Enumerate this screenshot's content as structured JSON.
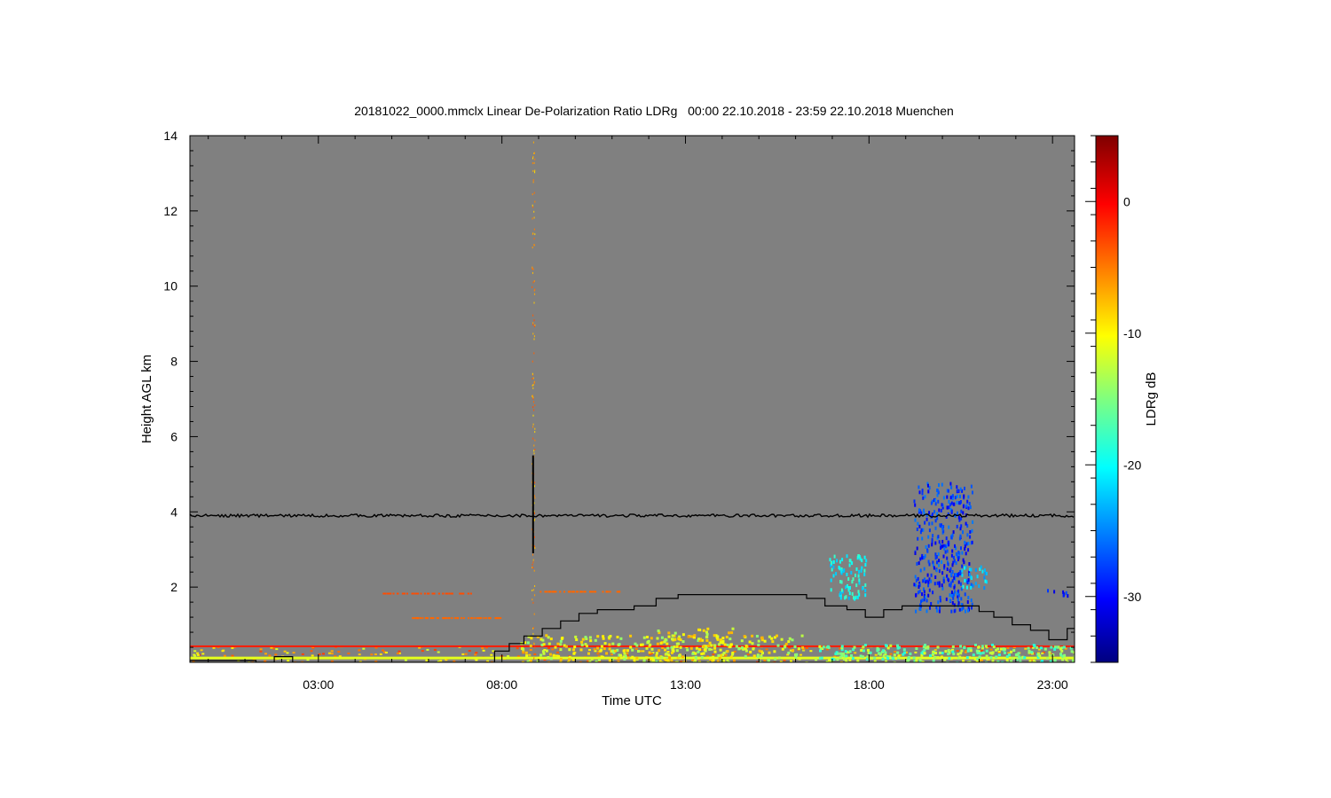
{
  "chart_data": {
    "type": "heatmap",
    "title": "20181022_0000.mmclx Linear De-Polarization Ratio LDRg   00:00 22.10.2018 - 23:59 22.10.2018 Muenchen",
    "xlabel": "Time UTC",
    "ylabel": "Height AGL km",
    "colorbar_label": "LDRg dB",
    "x_ticks": [
      "03:00",
      "08:00",
      "13:00",
      "18:00",
      "23:00"
    ],
    "x_tick_hours": [
      3,
      8,
      13,
      18,
      23
    ],
    "xlim_hours": [
      -0.5,
      23.6
    ],
    "y_ticks": [
      "2",
      "4",
      "6",
      "8",
      "10",
      "12",
      "14"
    ],
    "y_tick_values": [
      2,
      4,
      6,
      8,
      10,
      12,
      14
    ],
    "ylim_km": [
      0,
      14
    ],
    "colorbar_ticks": [
      "0",
      "-10",
      "-20",
      "-30"
    ],
    "colorbar_tick_values": [
      0,
      -10,
      -20,
      -30
    ],
    "colorbar_range_db": [
      -35,
      5
    ],
    "background_color": "#808080",
    "colormap": "jet",
    "reference_line_height_km": 3.9,
    "spike": {
      "time_hour": 8.85,
      "km_range": [
        2.9,
        5.5
      ]
    },
    "step_line": [
      {
        "t": -0.5,
        "km": 0.05
      },
      {
        "t": 0.8,
        "km": 0.05
      },
      {
        "t": 1.3,
        "km": 0.0
      },
      {
        "t": 1.8,
        "km": 0.15
      },
      {
        "t": 2.3,
        "km": 0.0
      },
      {
        "t": 7.3,
        "km": 0.0
      },
      {
        "t": 7.8,
        "km": 0.3
      },
      {
        "t": 8.2,
        "km": 0.5
      },
      {
        "t": 8.6,
        "km": 0.7
      },
      {
        "t": 9.1,
        "km": 0.9
      },
      {
        "t": 9.6,
        "km": 1.1
      },
      {
        "t": 10.1,
        "km": 1.3
      },
      {
        "t": 10.6,
        "km": 1.4
      },
      {
        "t": 11.6,
        "km": 1.5
      },
      {
        "t": 12.2,
        "km": 1.7
      },
      {
        "t": 12.8,
        "km": 1.8
      },
      {
        "t": 16.3,
        "km": 1.7
      },
      {
        "t": 16.8,
        "km": 1.5
      },
      {
        "t": 17.4,
        "km": 1.4
      },
      {
        "t": 17.9,
        "km": 1.2
      },
      {
        "t": 18.4,
        "km": 1.4
      },
      {
        "t": 18.9,
        "km": 1.5
      },
      {
        "t": 21.0,
        "km": 1.35
      },
      {
        "t": 21.4,
        "km": 1.2
      },
      {
        "t": 21.9,
        "km": 1.0
      },
      {
        "t": 22.4,
        "km": 0.85
      },
      {
        "t": 22.9,
        "km": 0.6
      },
      {
        "t": 23.4,
        "km": 0.9
      },
      {
        "t": 23.6,
        "km": 0.9
      }
    ],
    "cloud_regions": [
      {
        "t": [
          16.9,
          17.9
        ],
        "km": [
          1.7,
          2.9
        ],
        "ldr_db": -20
      },
      {
        "t": [
          19.2,
          20.8
        ],
        "km": [
          1.4,
          4.8
        ],
        "ldr_db": -28
      },
      {
        "t": [
          20.5,
          21.2
        ],
        "km": [
          2.0,
          2.6
        ],
        "ldr_db": -22
      },
      {
        "t": [
          22.8,
          23.4
        ],
        "km": [
          1.8,
          2.0
        ],
        "ldr_db": -30
      }
    ],
    "boundary_layer": [
      {
        "t": [
          8.5,
          16.2
        ],
        "km_top": 0.75,
        "ldr_db": -11
      },
      {
        "t": [
          12.0,
          14.3
        ],
        "km_top": 0.95,
        "ldr_db": -10
      },
      {
        "t": [
          16.5,
          23.6
        ],
        "km_top": 0.5,
        "ldr_db": -15
      }
    ],
    "surface_layer_ldr_db": [
      -2,
      -12
    ],
    "scatter_rows": [
      {
        "t": [
          4.7,
          7.2
        ],
        "km": 1.85,
        "ldr_db": -3
      },
      {
        "t": [
          9.0,
          11.2
        ],
        "km": 1.9,
        "ldr_db": -4
      },
      {
        "t": [
          5.5,
          8.0
        ],
        "km": 1.2,
        "ldr_db": -4
      }
    ]
  }
}
